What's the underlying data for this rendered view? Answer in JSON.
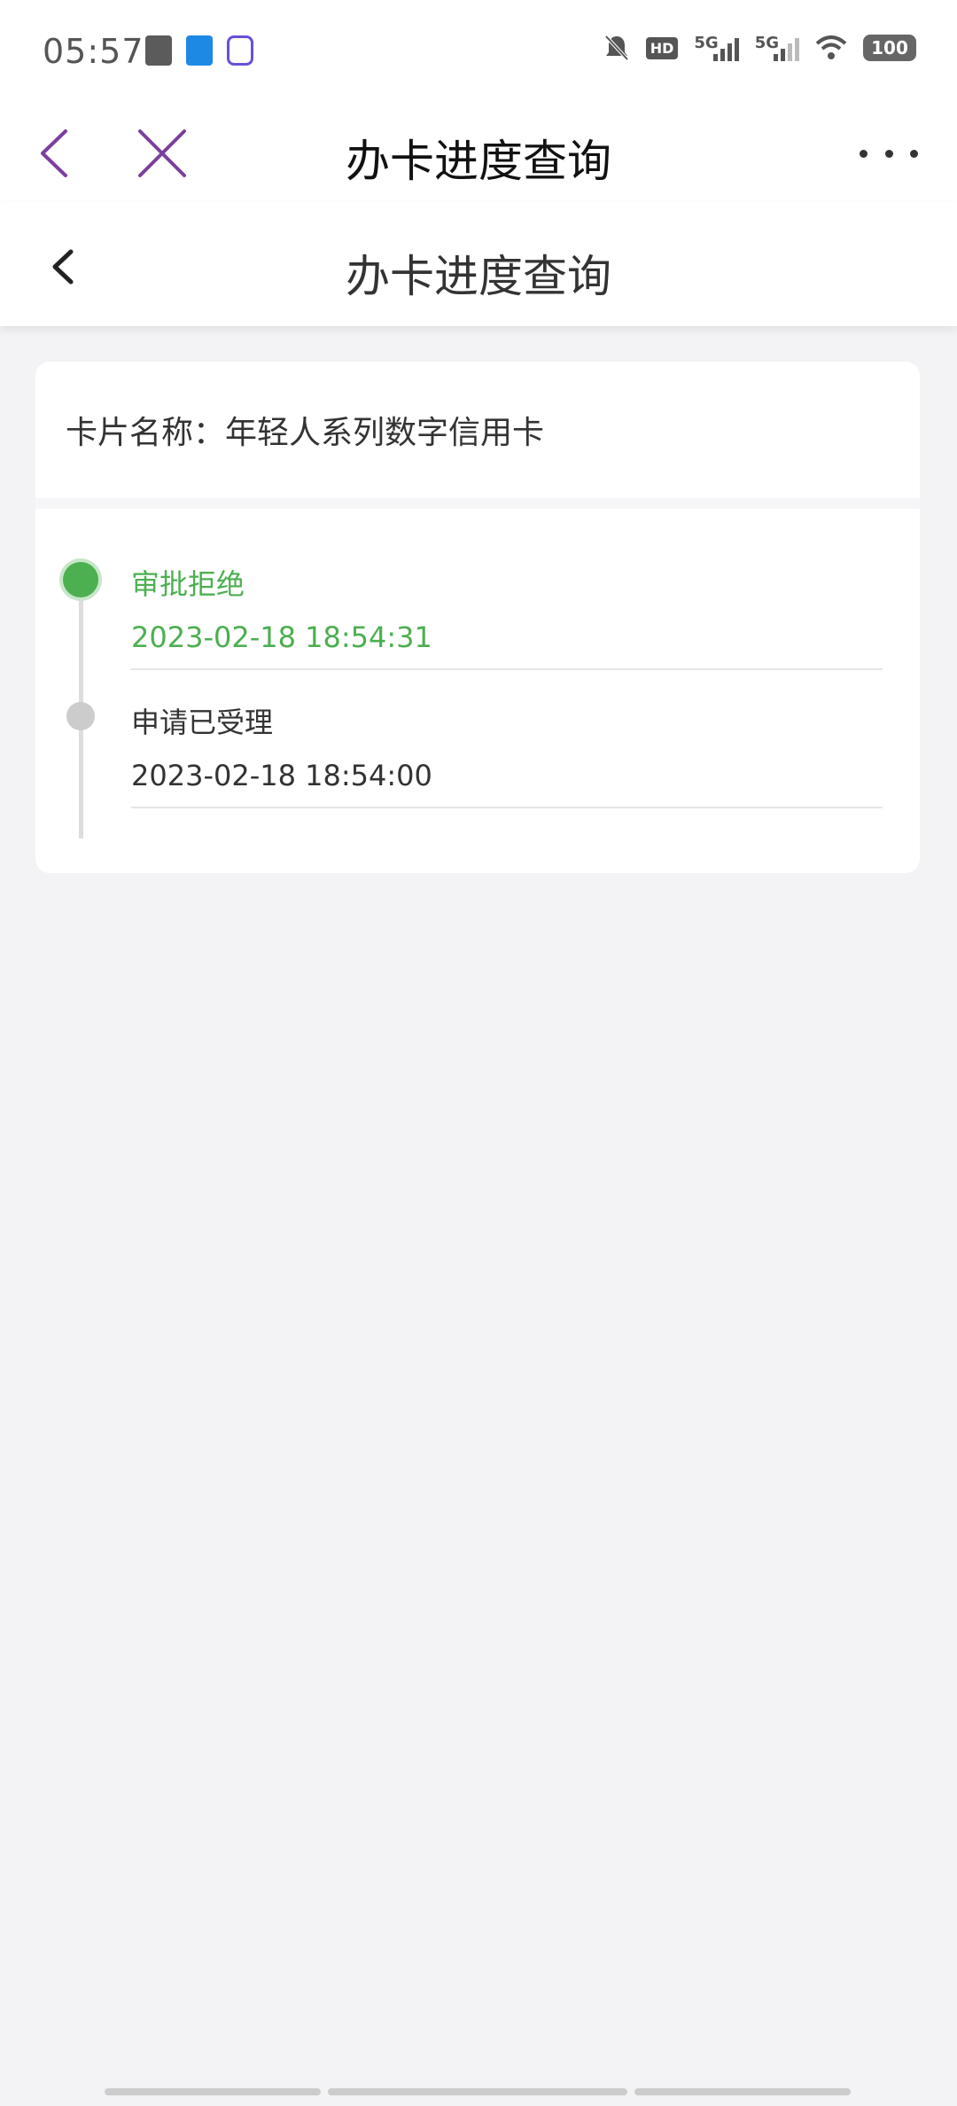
{
  "status_bar": {
    "time": "05:57",
    "battery": "100",
    "network1": "5G",
    "network2": "5G",
    "hd": "HD"
  },
  "nav_top": {
    "title": "办卡进度查询"
  },
  "nav_page": {
    "title": "办卡进度查询"
  },
  "card": {
    "name_label": "卡片名称：年轻人系列数字信用卡"
  },
  "timeline": [
    {
      "status": "审批拒绝",
      "time": "2023-02-18 18:54:31",
      "color": "#4caf50"
    },
    {
      "status": "申请已受理",
      "time": "2023-02-18 18:54:00",
      "color": "#333333"
    }
  ],
  "colors": {
    "accent_purple": "#7b3f9e",
    "success_green": "#4caf50"
  }
}
